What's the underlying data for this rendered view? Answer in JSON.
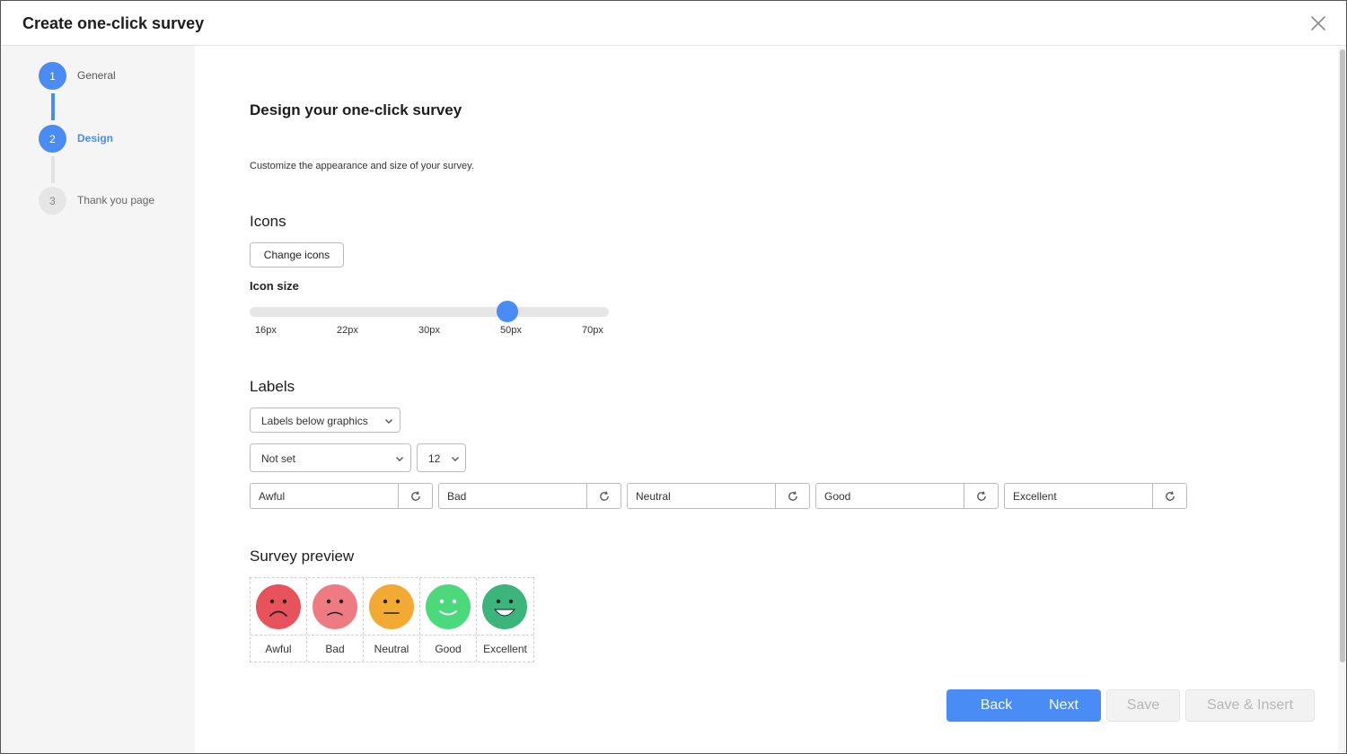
{
  "dialog": {
    "title": "Create one-click survey"
  },
  "steps": [
    {
      "number": "1",
      "label": "General",
      "state": "done"
    },
    {
      "number": "2",
      "label": "Design",
      "state": "current"
    },
    {
      "number": "3",
      "label": "Thank you page",
      "state": "todo"
    }
  ],
  "content": {
    "heading": "Design your one-click survey",
    "description": "Customize the appearance and size of your survey."
  },
  "icons_section": {
    "heading": "Icons",
    "change_button": "Change icons",
    "size_label": "Icon size",
    "size_ticks": [
      "16px",
      "22px",
      "30px",
      "50px",
      "70px"
    ],
    "selected_size": "50px",
    "selected_index": 3
  },
  "labels_section": {
    "heading": "Labels",
    "position_select": "Labels below graphics",
    "font_select": "Not set",
    "font_size_select": "12",
    "fields": [
      "Awful",
      "Bad",
      "Neutral",
      "Good",
      "Excellent"
    ]
  },
  "preview": {
    "heading": "Survey preview",
    "items": [
      {
        "label": "Awful",
        "color": "#e8525b",
        "mood": "very-sad"
      },
      {
        "label": "Bad",
        "color": "#ee7a82",
        "mood": "sad"
      },
      {
        "label": "Neutral",
        "color": "#f2aa33",
        "mood": "neutral"
      },
      {
        "label": "Good",
        "color": "#4cd97b",
        "mood": "happy"
      },
      {
        "label": "Excellent",
        "color": "#3bb57a",
        "mood": "very-happy"
      }
    ]
  },
  "footer": {
    "back": "Back",
    "next": "Next",
    "save": "Save",
    "save_insert": "Save & Insert"
  },
  "colors": {
    "accent": "#4a8cf5",
    "sidebar_bg": "#f5f5f5",
    "disabled_text": "#b7b7b7"
  },
  "icon_names": {
    "close": "close-icon",
    "chevron": "chevron-down-icon",
    "reset": "reset-icon"
  }
}
